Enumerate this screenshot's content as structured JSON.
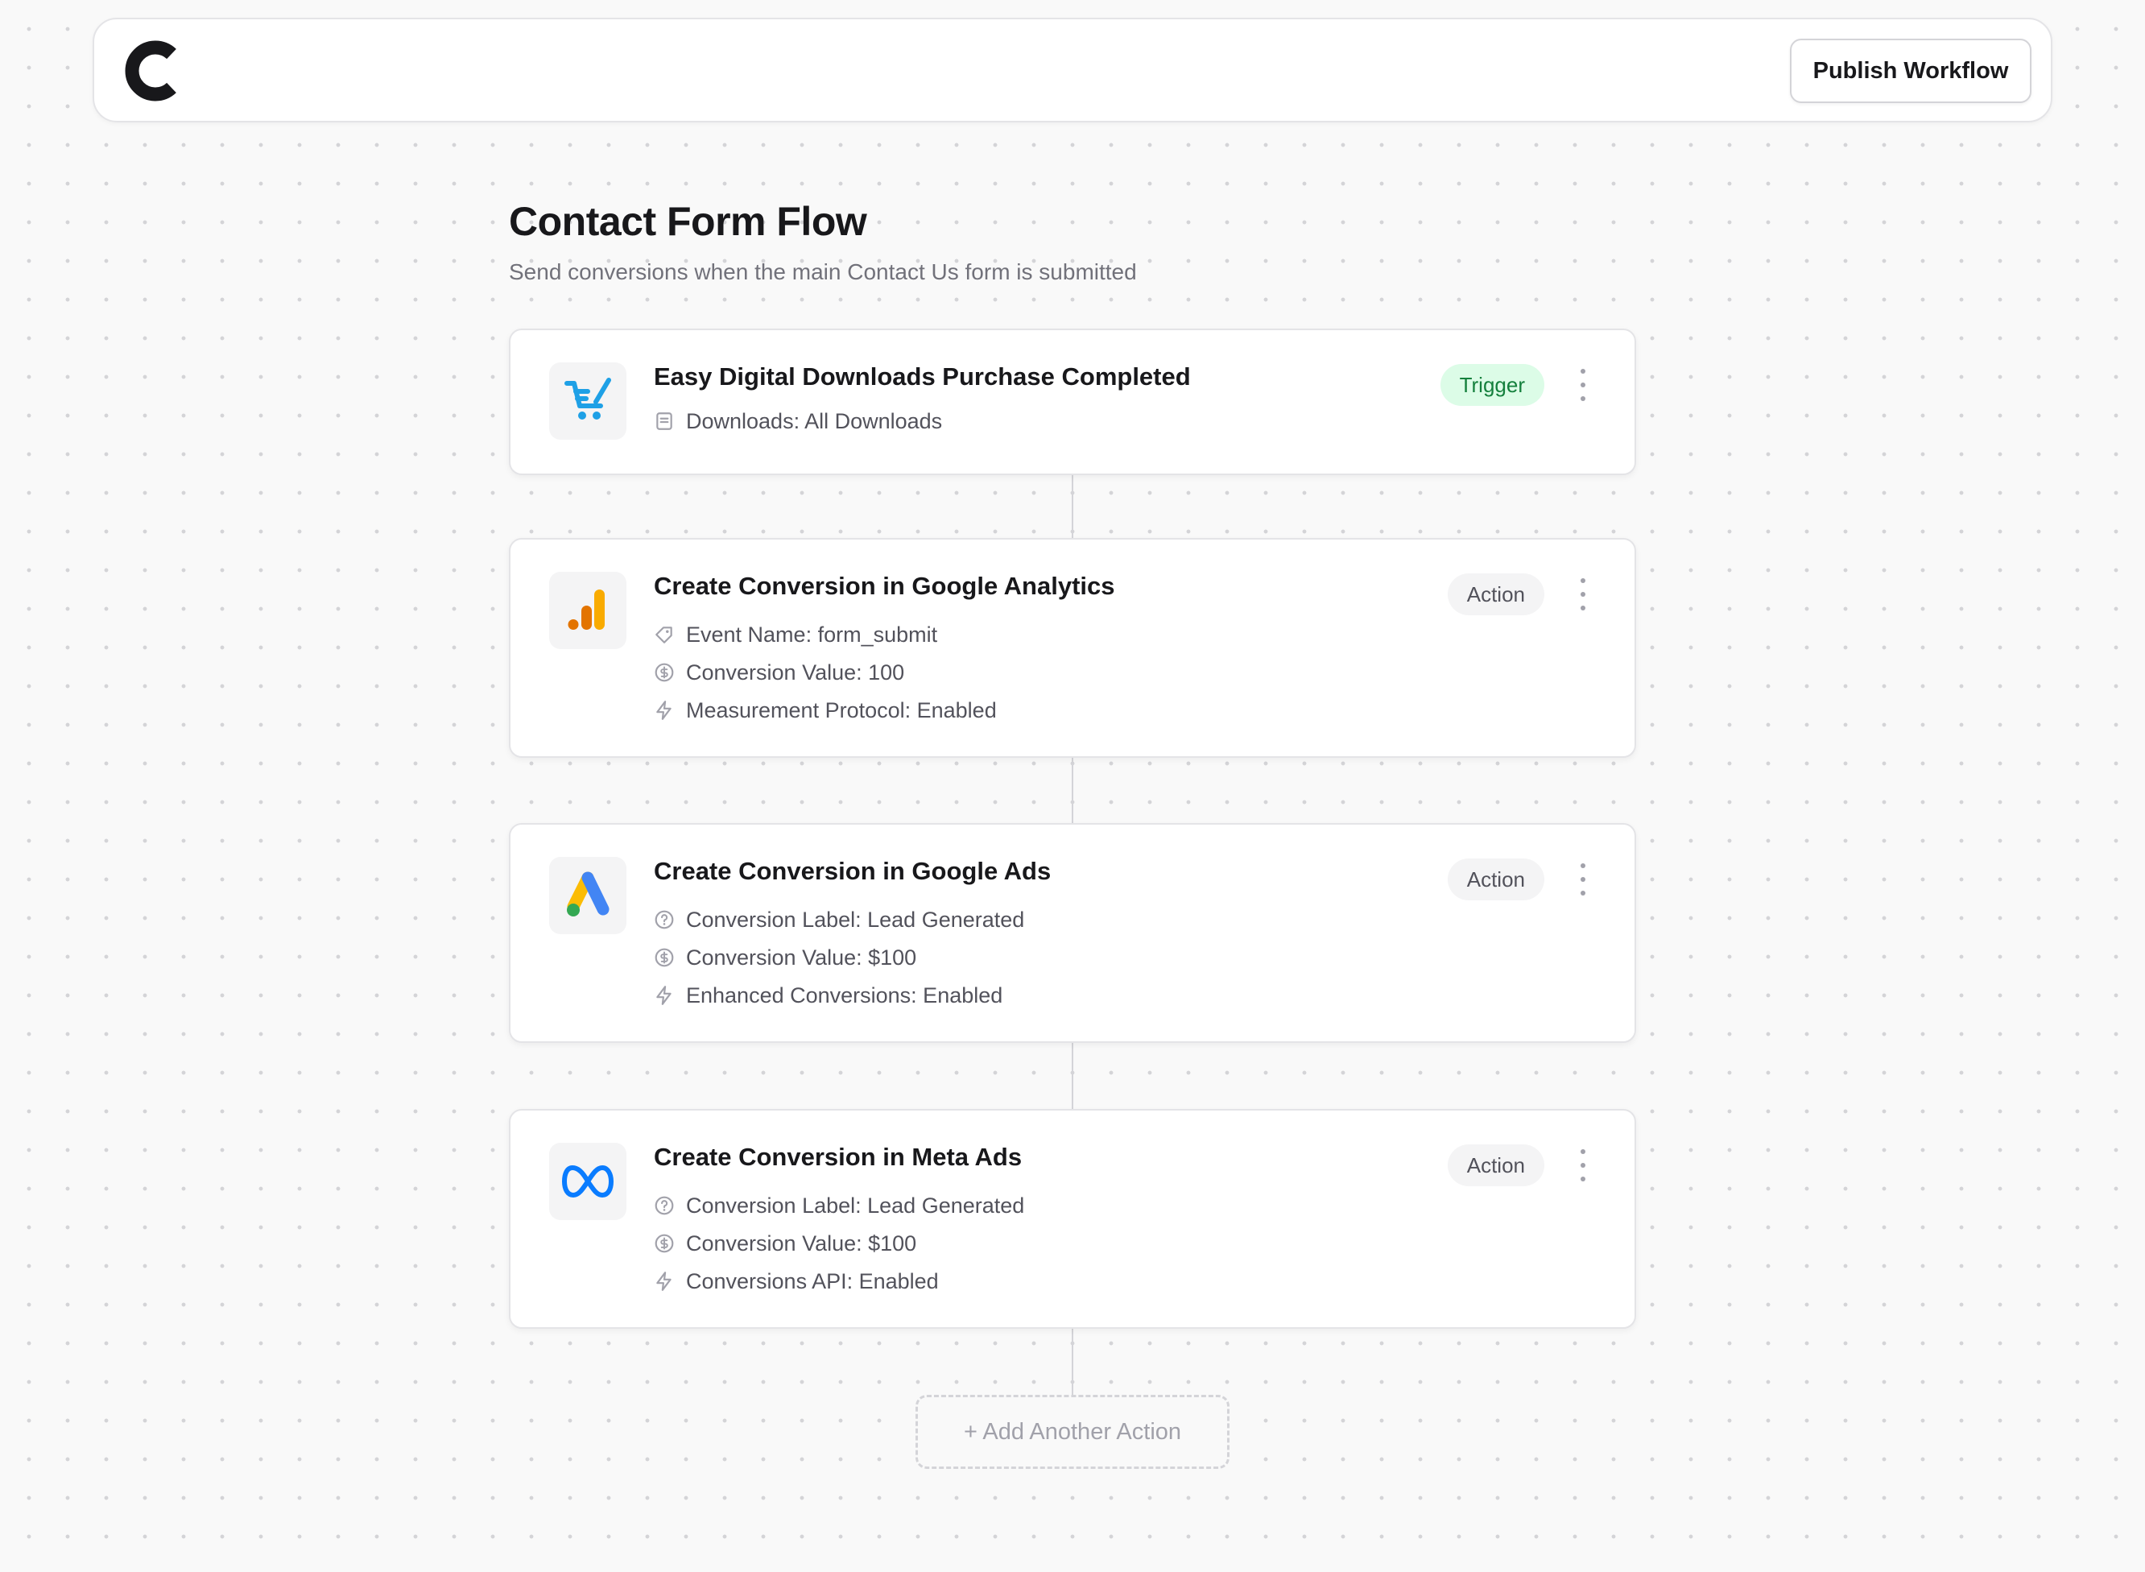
{
  "header": {
    "logo_icon": "c-logo-icon",
    "publish_label": "Publish Workflow"
  },
  "workflow": {
    "title": "Contact Form Flow",
    "subtitle": "Send conversions when the main Contact Us form is submitted"
  },
  "steps": [
    {
      "title": "Easy Digital Downloads Purchase Completed",
      "badge": "Trigger",
      "icon": "edd-cart-icon",
      "details": [
        {
          "icon": "document-icon",
          "text": "Downloads: All Downloads"
        }
      ]
    },
    {
      "title": "Create Conversion in Google Analytics",
      "badge": "Action",
      "icon": "google-analytics-icon",
      "details": [
        {
          "icon": "tag-icon",
          "text": "Event Name: form_submit"
        },
        {
          "icon": "dollar-circle-icon",
          "text": "Conversion Value: 100"
        },
        {
          "icon": "lightning-icon",
          "text": "Measurement Protocol: Enabled"
        }
      ]
    },
    {
      "title": "Create Conversion in Google Ads",
      "badge": "Action",
      "icon": "google-ads-icon",
      "details": [
        {
          "icon": "help-circle-icon",
          "text": "Conversion Label: Lead Generated"
        },
        {
          "icon": "dollar-circle-icon",
          "text": "Conversion Value: $100"
        },
        {
          "icon": "lightning-icon",
          "text": "Enhanced Conversions: Enabled"
        }
      ]
    },
    {
      "title": "Create Conversion in Meta Ads",
      "badge": "Action",
      "icon": "meta-icon",
      "details": [
        {
          "icon": "help-circle-icon",
          "text": "Conversion Label: Lead Generated"
        },
        {
          "icon": "dollar-circle-icon",
          "text": "Conversion Value: $100"
        },
        {
          "icon": "lightning-icon",
          "text": "Conversions API: Enabled"
        }
      ]
    }
  ],
  "add_action_label": "+ Add Another Action",
  "colors": {
    "trigger_badge_bg": "#dcfce7",
    "trigger_badge_text": "#15803d",
    "action_badge_bg": "#f4f4f5",
    "edd_blue": "#1ea0e6",
    "ga_orange": "#f9ab00",
    "ga_dark_orange": "#e37400",
    "ads_blue": "#4285f4",
    "ads_yellow": "#fbbc04",
    "ads_green": "#34a853",
    "meta_blue": "#0a7cff"
  }
}
